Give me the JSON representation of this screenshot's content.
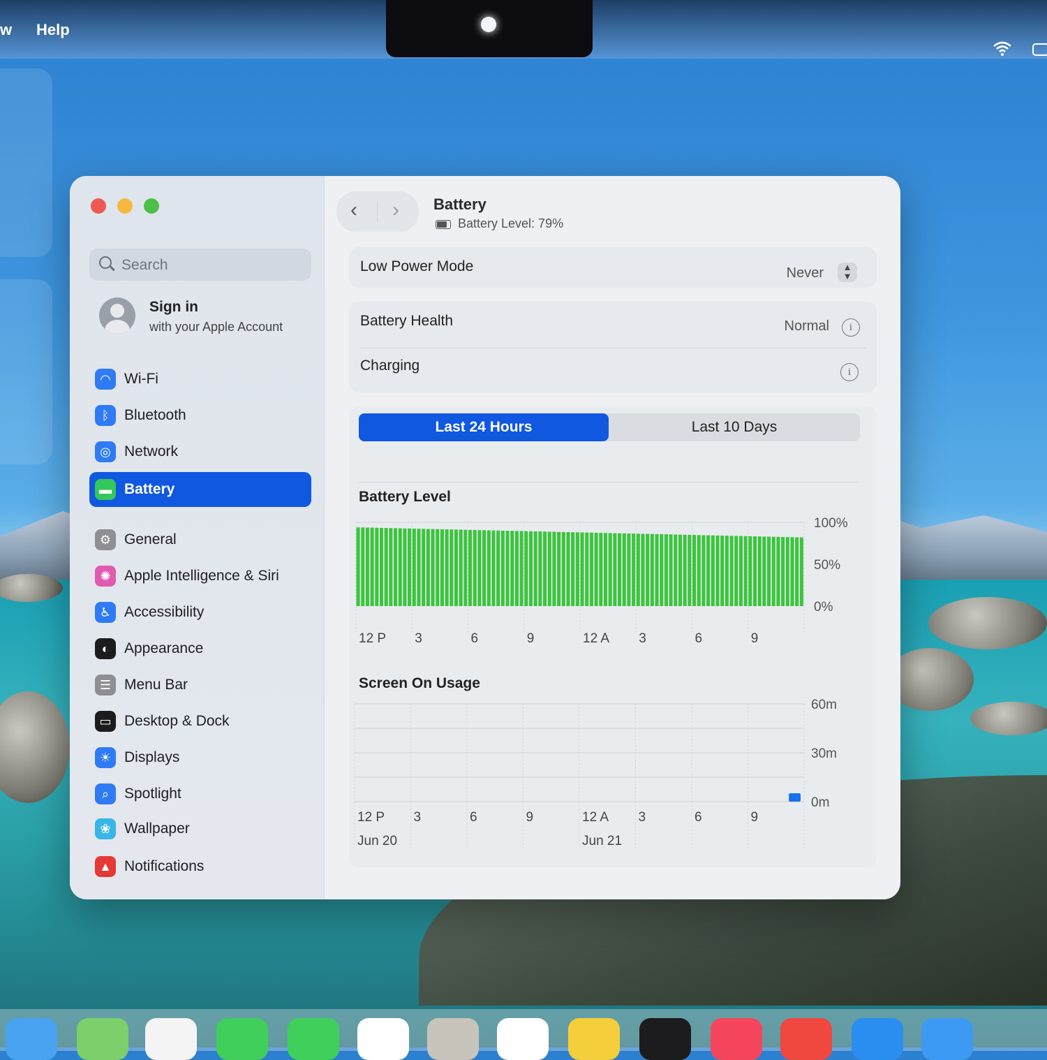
{
  "menubar": {
    "menus": [
      "w",
      "Help"
    ]
  },
  "window": {
    "search": {
      "placeholder": "Search"
    },
    "account": {
      "title": "Sign in",
      "subtitle": "with your Apple Account"
    },
    "sidebar": {
      "items": [
        {
          "label": "Wi-Fi",
          "icon": "wifi-icon",
          "color": "#2f7bf5"
        },
        {
          "label": "Bluetooth",
          "icon": "bluetooth-icon",
          "color": "#2f7bf5"
        },
        {
          "label": "Network",
          "icon": "globe-icon",
          "color": "#2f7bf5"
        },
        {
          "label": "Battery",
          "icon": "battery-icon",
          "color": "#34c759",
          "selected": true
        },
        {
          "label": "General",
          "icon": "gear-icon",
          "color": "#8e8e93"
        },
        {
          "label": "Apple Intelligence & Siri",
          "icon": "siri-icon",
          "color": "#e05ab0"
        },
        {
          "label": "Accessibility",
          "icon": "accessibility-icon",
          "color": "#2f7bf5"
        },
        {
          "label": "Appearance",
          "icon": "appearance-icon",
          "color": "#1c1c1e"
        },
        {
          "label": "Menu Bar",
          "icon": "menubar-icon",
          "color": "#8e8e93"
        },
        {
          "label": "Desktop & Dock",
          "icon": "dock-icon",
          "color": "#1c1c1e"
        },
        {
          "label": "Displays",
          "icon": "sun-icon",
          "color": "#2f7bf5"
        },
        {
          "label": "Spotlight",
          "icon": "spotlight-icon",
          "color": "#2f7bf5"
        },
        {
          "label": "Wallpaper",
          "icon": "flower-icon",
          "color": "#38b6e8"
        },
        {
          "label": "Notifications",
          "icon": "bell-icon",
          "color": "#e53935"
        }
      ]
    },
    "header": {
      "title": "Battery",
      "subtitle": "Battery Level: 79%"
    },
    "low_power": {
      "label": "Low Power Mode",
      "value": "Never"
    },
    "health": {
      "label": "Battery Health",
      "value": "Normal"
    },
    "charging": {
      "label": "Charging"
    },
    "tabs": [
      {
        "label": "Last 24 Hours",
        "active": true
      },
      {
        "label": "Last 10 Days",
        "active": false
      }
    ],
    "accent": "#1058e0"
  },
  "chart_data": [
    {
      "type": "bar",
      "title": "Battery Level",
      "x_ticks": [
        "12 P",
        "3",
        "6",
        "9",
        "12 A",
        "3",
        "6",
        "9"
      ],
      "y_ticks": [
        "100%",
        "50%",
        "0%"
      ],
      "ylim": [
        0,
        100
      ],
      "bar_count": 96,
      "value_start": 94,
      "value_end": 82,
      "series_color": "#3dc43f"
    },
    {
      "type": "bar",
      "title": "Screen On Usage",
      "x_ticks": [
        "12 P",
        "3",
        "6",
        "9",
        "12 A",
        "3",
        "6",
        "9"
      ],
      "date_labels": [
        {
          "label": "Jun 20",
          "tick": 0
        },
        {
          "label": "Jun 21",
          "tick": 4
        }
      ],
      "y_ticks": [
        "60m",
        "30m",
        "0m"
      ],
      "ylim": [
        0,
        60
      ],
      "bars": [
        {
          "hour_index": 23,
          "value_minutes": 5
        }
      ],
      "series_color": "#1a6ff0"
    }
  ]
}
